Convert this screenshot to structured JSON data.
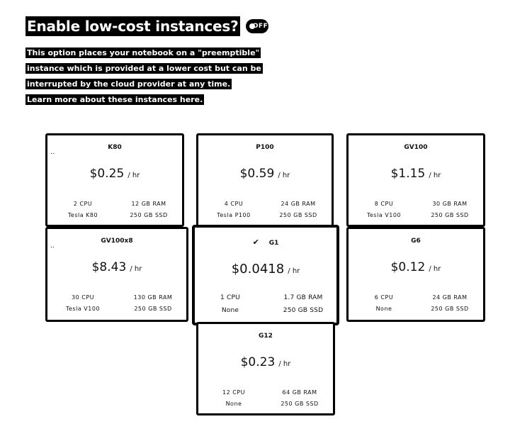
{
  "header": {
    "title": "Enable low-cost instances?",
    "toggle_label": "OFF"
  },
  "description": {
    "line1": "This option places your notebook on a \"preemptible\"",
    "line2": "instance which is provided at a lower cost but can be",
    "line3": "interrupted by the cloud provider at any time.",
    "link": "Learn more about these instances here."
  },
  "instances": [
    {
      "name": "K80",
      "dots": "..",
      "price": "$0.25",
      "unit": "/ hr",
      "cpu": "2 CPU",
      "ram": "12 GB RAM",
      "gpu": "Tesla K80",
      "disk": "250 GB SSD"
    },
    {
      "name": "P100",
      "price": "$0.59",
      "unit": "/ hr",
      "cpu": "4 CPU",
      "ram": "24 GB RAM",
      "gpu": "Tesla P100",
      "disk": "250 GB SSD"
    },
    {
      "name": "GV100",
      "price": "$1.15",
      "unit": "/ hr",
      "cpu": "8 CPU",
      "ram": "30 GB RAM",
      "gpu": "Tesla V100",
      "disk": "250 GB SSD"
    },
    {
      "name": "GV100x8",
      "dots": "..",
      "price": "$8.43",
      "unit": "/ hr",
      "cpu": "30 CPU",
      "ram": "130 GB RAM",
      "gpu": "Tesla V100",
      "disk": "250 GB SSD"
    },
    {
      "name": "G1",
      "selected_icon": "✔",
      "price": "$0.0418",
      "unit": "/ hr",
      "cpu": "1 CPU",
      "ram": "1.7 GB RAM",
      "gpu": "None",
      "disk": "250 GB SSD"
    },
    {
      "name": "G6",
      "price": "$0.12",
      "unit": "/ hr",
      "cpu": "6 CPU",
      "ram": "24 GB RAM",
      "gpu": "None",
      "disk": "250 GB SSD"
    },
    {
      "name": "G12",
      "price": "$0.23",
      "unit": "/ hr",
      "cpu": "12 CPU",
      "ram": "64 GB RAM",
      "gpu": "None",
      "disk": "250 GB SSD"
    }
  ]
}
